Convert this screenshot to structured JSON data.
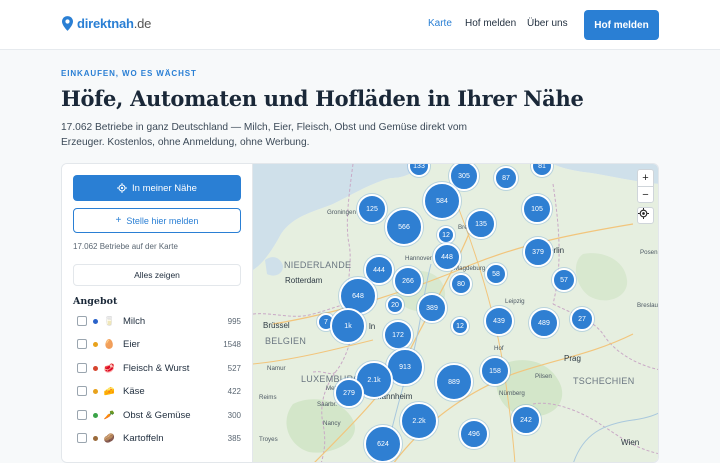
{
  "header": {
    "logo": {
      "brand": "direktnah",
      "tld": ".de"
    },
    "nav": [
      {
        "label": "Karte",
        "active": true
      },
      {
        "label": "Hof melden",
        "active": false
      },
      {
        "label": "Über uns",
        "active": false
      }
    ],
    "cta": "Hof melden"
  },
  "hero": {
    "eyebrow": "EINKAUFEN, WO ES WÄCHST",
    "title": "Höfe, Automaten und Hofläden in Ihrer Nähe",
    "lede": "17.062 Betriebe in ganz Deutschland — Milch, Eier, Fleisch, Obst und Gemüse direkt vom Erzeuger. Kostenlos, ohne Anmeldung, ohne Werbung."
  },
  "sidebar": {
    "near_button": "In meiner Nähe",
    "report_button": "Stelle hier melden",
    "count_text": "17.062 Betriebe auf der Karte",
    "show_all": "Alles zeigen",
    "section_title": "Angebot",
    "filters": [
      {
        "label": "Milch",
        "count": "995",
        "dot": "#2a62c9",
        "icon": "milk-icon",
        "glyph": "🥛"
      },
      {
        "label": "Eier",
        "count": "1548",
        "dot": "#e8a21c",
        "icon": "egg-icon",
        "glyph": "🥚"
      },
      {
        "label": "Fleisch & Wurst",
        "count": "527",
        "dot": "#d6452e",
        "icon": "meat-icon",
        "glyph": "🥩"
      },
      {
        "label": "Käse",
        "count": "422",
        "dot": "#e8a21c",
        "icon": "cheese-icon",
        "glyph": "🧀"
      },
      {
        "label": "Obst & Gemüse",
        "count": "300",
        "dot": "#3aa348",
        "icon": "carrot-icon",
        "glyph": "🥕"
      },
      {
        "label": "Kartoffeln",
        "count": "385",
        "dot": "#9a6a3a",
        "icon": "potato-icon",
        "glyph": "🥔"
      }
    ]
  },
  "map": {
    "labels": [
      {
        "text": "Groningen",
        "kind": "small"
      },
      {
        "text": "NIEDERLANDE",
        "kind": "big"
      },
      {
        "text": "Rotterdam",
        "kind": "mid"
      },
      {
        "text": "Brüssel",
        "kind": "mid"
      },
      {
        "text": "BELGIEN",
        "kind": "big"
      },
      {
        "text": "LUXEMBURG",
        "kind": "big"
      },
      {
        "text": "Reims",
        "kind": "small"
      },
      {
        "text": "Saarbr.",
        "kind": "small"
      },
      {
        "text": "Nancy",
        "kind": "small"
      },
      {
        "text": "Troyes",
        "kind": "small"
      },
      {
        "text": "Mannheim",
        "kind": "mid"
      },
      {
        "text": "Prag",
        "kind": "mid"
      },
      {
        "text": "TSCHECHIEN",
        "kind": "big"
      },
      {
        "text": "Wien",
        "kind": "mid"
      },
      {
        "text": "Breslau",
        "kind": "small"
      },
      {
        "text": "Posen",
        "kind": "small"
      },
      {
        "text": "Pilsen",
        "kind": "small"
      },
      {
        "text": "Nürnberg",
        "kind": "small"
      },
      {
        "text": "Leipzig",
        "kind": "small"
      },
      {
        "text": "Hannover",
        "kind": "small"
      },
      {
        "text": "Magdeburg",
        "kind": "small"
      },
      {
        "text": "Hof",
        "kind": "small"
      },
      {
        "text": "erlin",
        "kind": "mid"
      },
      {
        "text": "ln",
        "kind": "mid"
      },
      {
        "text": "Metz",
        "kind": "small"
      },
      {
        "text": "Namur",
        "kind": "small"
      },
      {
        "text": "Bremen",
        "kind": "small"
      }
    ],
    "clusters": [
      "133",
      "305",
      "87",
      "81",
      "125",
      "584",
      "105",
      "566",
      "12",
      "135",
      "379",
      "448",
      "444",
      "266",
      "80",
      "58",
      "57",
      "648",
      "20",
      "389",
      "12",
      "7",
      "1k",
      "172",
      "439",
      "489",
      "27",
      "913",
      "2.1k",
      "889",
      "158",
      "279",
      "242",
      "2.2k",
      "496",
      "624"
    ],
    "cluster_color": "#2f7fd2"
  }
}
